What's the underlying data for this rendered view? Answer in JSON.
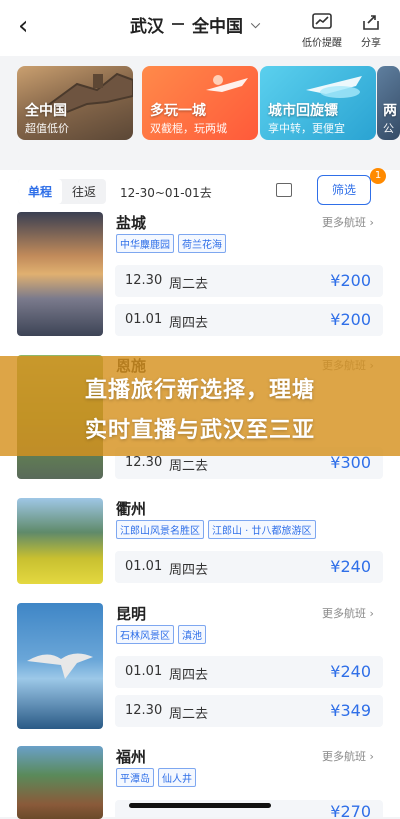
{
  "header": {
    "back_glyph": "‹",
    "origin": "武汉",
    "destination": "全中国",
    "price_alert_label": "低价提醒",
    "share_label": "分享"
  },
  "promo_cards": [
    {
      "title": "全中国",
      "subtitle": "超值低价",
      "color": "#7b6048"
    },
    {
      "title": "多玩一城",
      "subtitle": "双截棍，玩两城",
      "color": "#ff6a3a"
    },
    {
      "title": "城市回旋镖",
      "subtitle": "享中转，更便宜",
      "color": "#33b1d8"
    },
    {
      "title": "两",
      "subtitle": "公",
      "color": "#4a6a8a"
    }
  ],
  "filters": {
    "tabs": [
      {
        "label": "单程"
      },
      {
        "label": "往返"
      }
    ],
    "date_range": "12-30~01-01去",
    "filter_label": "筛选",
    "filter_count": "1"
  },
  "more_label": "更多航班",
  "destinations": [
    {
      "city": "盐城",
      "tags": [
        "中华麋鹿园",
        "荷兰花海"
      ],
      "show_more": true,
      "fares": [
        {
          "date": "12.30",
          "weekday": "周二去",
          "price": "¥200"
        },
        {
          "date": "01.01",
          "weekday": "周四去",
          "price": "¥200"
        }
      ]
    },
    {
      "city": "恩施",
      "tags": [],
      "show_more": true,
      "fares": [
        {
          "date": "12.30",
          "weekday": "周二去",
          "price": "¥300"
        }
      ]
    },
    {
      "city": "衢州",
      "tags": [
        "江郎山风景名胜区",
        "江郎山 · 廿八都旅游区"
      ],
      "show_more": false,
      "fares": [
        {
          "date": "01.01",
          "weekday": "周四去",
          "price": "¥240"
        }
      ]
    },
    {
      "city": "昆明",
      "tags": [
        "石林风景区",
        "滇池"
      ],
      "show_more": true,
      "fares": [
        {
          "date": "01.01",
          "weekday": "周四去",
          "price": "¥240"
        },
        {
          "date": "12.30",
          "weekday": "周二去",
          "price": "¥349"
        }
      ]
    },
    {
      "city": "福州",
      "tags": [
        "平潭岛",
        "仙人井"
      ],
      "show_more": true,
      "fares": [
        {
          "date": "",
          "weekday": "",
          "price": "¥270"
        }
      ]
    }
  ],
  "overlay_banner": {
    "line1": "直播旅行新选择，理塘",
    "line2": "实时直播与武汉至三亚"
  }
}
